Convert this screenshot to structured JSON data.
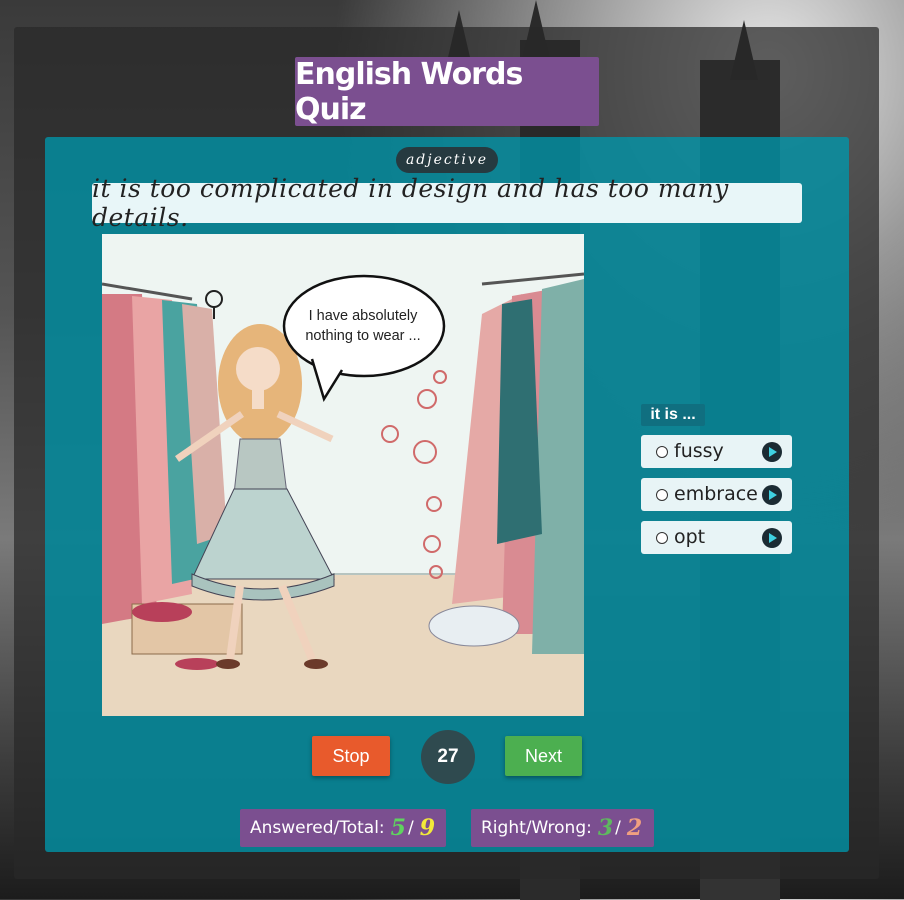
{
  "app": {
    "title": "English Words Quiz"
  },
  "question": {
    "part_of_speech": "adjective",
    "definition": "it is too complicated in design and has too many details.",
    "image_speech_bubble": "I have absolutely nothing to wear ..."
  },
  "answers": {
    "prompt": "it is ...",
    "options": [
      {
        "label": "fussy"
      },
      {
        "label": "embrace"
      },
      {
        "label": "opt"
      }
    ]
  },
  "controls": {
    "stop_label": "Stop",
    "next_label": "Next",
    "counter": "27"
  },
  "stats": {
    "answered_total_label": "Answered/Total:",
    "answered": "5",
    "total": "9",
    "right_wrong_label": "Right/Wrong:",
    "right": "3",
    "wrong": "2",
    "separator": "/"
  },
  "colors": {
    "title_bg": "#7b4f90",
    "card_bg": "#0096aa",
    "stop": "#e85a2c",
    "next": "#4caf50",
    "answered_value": "#5fd35f",
    "total_value": "#f2e93a",
    "right_value": "#5fb85f",
    "wrong_value": "#f0a080"
  },
  "icons": [
    "play-audio-icon",
    "radio-icon",
    "female-symbol-icon"
  ]
}
